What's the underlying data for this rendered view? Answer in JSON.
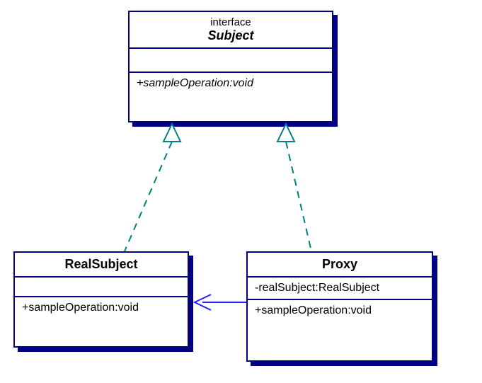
{
  "subject": {
    "stereotype": "interface",
    "name": "Subject",
    "operation": "+sampleOperation:void"
  },
  "realSubject": {
    "name": "RealSubject",
    "operation": "+sampleOperation:void"
  },
  "proxy": {
    "name": "Proxy",
    "attribute": "-realSubject:RealSubject",
    "operation": "+sampleOperation:void"
  },
  "colors": {
    "border": "#000080",
    "shadow": "#000080",
    "realization": "#008080",
    "association": "#2020FF"
  }
}
